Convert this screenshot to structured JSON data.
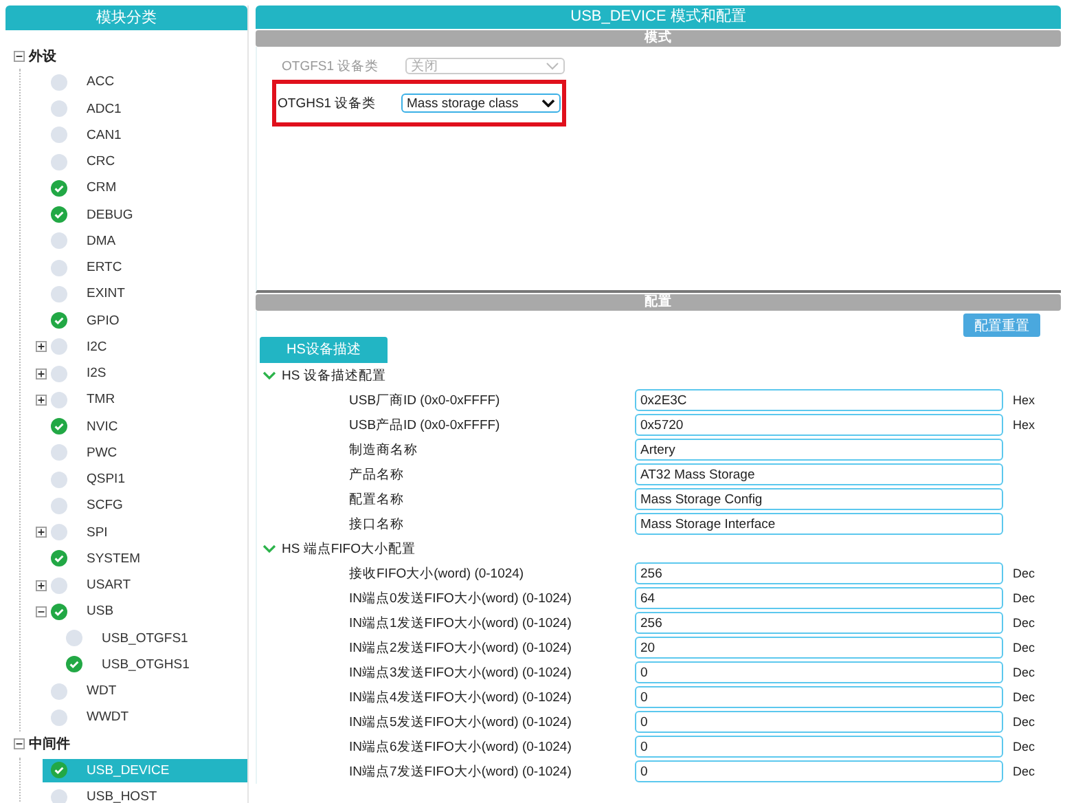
{
  "sidebar": {
    "title": "模块分类",
    "groups": [
      {
        "label": "外设",
        "expanded": true,
        "children": [
          {
            "label": "ACC",
            "enabled": false,
            "selected": false
          },
          {
            "label": "ADC1",
            "enabled": false,
            "selected": false
          },
          {
            "label": "CAN1",
            "enabled": false,
            "selected": false
          },
          {
            "label": "CRC",
            "enabled": false,
            "selected": false
          },
          {
            "label": "CRM",
            "enabled": true,
            "selected": false
          },
          {
            "label": "DEBUG",
            "enabled": true,
            "selected": false
          },
          {
            "label": "DMA",
            "enabled": false,
            "selected": false
          },
          {
            "label": "ERTC",
            "enabled": false,
            "selected": false
          },
          {
            "label": "EXINT",
            "enabled": false,
            "selected": false
          },
          {
            "label": "GPIO",
            "enabled": true,
            "selected": false
          },
          {
            "label": "I2C",
            "enabled": false,
            "selected": false,
            "expanded": false
          },
          {
            "label": "I2S",
            "enabled": false,
            "selected": false,
            "expanded": false
          },
          {
            "label": "TMR",
            "enabled": false,
            "selected": false,
            "expanded": false
          },
          {
            "label": "NVIC",
            "enabled": true,
            "selected": false
          },
          {
            "label": "PWC",
            "enabled": false,
            "selected": false
          },
          {
            "label": "QSPI1",
            "enabled": false,
            "selected": false
          },
          {
            "label": "SCFG",
            "enabled": false,
            "selected": false
          },
          {
            "label": "SPI",
            "enabled": false,
            "selected": false,
            "expanded": false
          },
          {
            "label": "SYSTEM",
            "enabled": true,
            "selected": false
          },
          {
            "label": "USART",
            "enabled": false,
            "selected": false,
            "expanded": false
          },
          {
            "label": "USB",
            "enabled": true,
            "selected": false,
            "expanded": true,
            "children": [
              {
                "label": "USB_OTGFS1",
                "enabled": false,
                "selected": false
              },
              {
                "label": "USB_OTGHS1",
                "enabled": true,
                "selected": false
              }
            ]
          },
          {
            "label": "WDT",
            "enabled": false,
            "selected": false
          },
          {
            "label": "WWDT",
            "enabled": false,
            "selected": false
          }
        ]
      },
      {
        "label": "中间件",
        "expanded": true,
        "children": [
          {
            "label": "USB_DEVICE",
            "enabled": true,
            "selected": true
          },
          {
            "label": "USB_HOST",
            "enabled": false,
            "selected": false
          }
        ]
      }
    ]
  },
  "main": {
    "title": "USB_DEVICE 模式和配置",
    "mode": {
      "title": "模式",
      "rows": [
        {
          "label": "OTGFS1 设备类",
          "value": "关闭",
          "disabled": true,
          "highlighted": false
        },
        {
          "label": "OTGHS1 设备类",
          "value": "Mass storage class",
          "disabled": false,
          "highlighted": true
        }
      ]
    },
    "config": {
      "title": "配置",
      "reset_button": "配置重置",
      "tabs": [
        {
          "label": "HS设备描述",
          "selected": true
        }
      ],
      "sections": [
        {
          "title": "HS 设备描述配置",
          "expanded": true,
          "fields": [
            {
              "label": "USB厂商ID (0x0-0xFFFF)",
              "value": "0x2E3C",
              "unit": "Hex"
            },
            {
              "label": "USB产品ID (0x0-0xFFFF)",
              "value": "0x5720",
              "unit": "Hex"
            },
            {
              "label": "制造商名称",
              "value": "Artery"
            },
            {
              "label": "产品名称",
              "value": "AT32 Mass Storage"
            },
            {
              "label": "配置名称",
              "value": "Mass Storage Config"
            },
            {
              "label": "接口名称",
              "value": "Mass Storage Interface"
            }
          ]
        },
        {
          "title": "HS 端点FIFO大小配置",
          "expanded": true,
          "fields": [
            {
              "label": "接收FIFO大小(word) (0-1024)",
              "value": "256",
              "unit": "Dec"
            },
            {
              "label": "IN端点0发送FIFO大小(word) (0-1024)",
              "value": "64",
              "unit": "Dec"
            },
            {
              "label": "IN端点1发送FIFO大小(word) (0-1024)",
              "value": "256",
              "unit": "Dec"
            },
            {
              "label": "IN端点2发送FIFO大小(word) (0-1024)",
              "value": "20",
              "unit": "Dec"
            },
            {
              "label": "IN端点3发送FIFO大小(word) (0-1024)",
              "value": "0",
              "unit": "Dec"
            },
            {
              "label": "IN端点4发送FIFO大小(word) (0-1024)",
              "value": "0",
              "unit": "Dec"
            },
            {
              "label": "IN端点5发送FIFO大小(word) (0-1024)",
              "value": "0",
              "unit": "Dec"
            },
            {
              "label": "IN端点6发送FIFO大小(word) (0-1024)",
              "value": "0",
              "unit": "Dec"
            },
            {
              "label": "IN端点7发送FIFO大小(word) (0-1024)",
              "value": "0",
              "unit": "Dec"
            }
          ]
        }
      ]
    }
  }
}
